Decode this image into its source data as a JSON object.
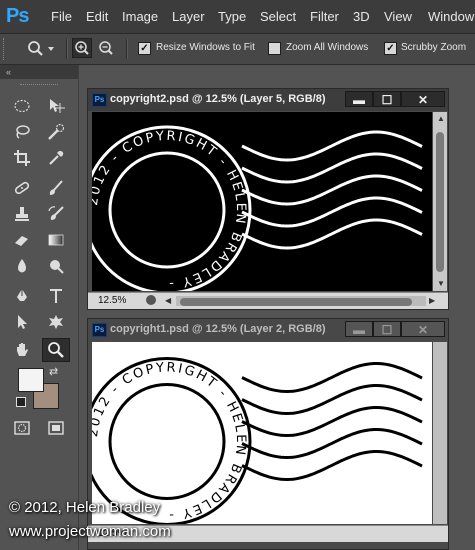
{
  "app": {
    "logo": "Ps"
  },
  "menu": [
    "File",
    "Edit",
    "Image",
    "Layer",
    "Type",
    "Select",
    "Filter",
    "3D",
    "View",
    "Window"
  ],
  "options": {
    "resize_windows": "Resize Windows to Fit",
    "zoom_all": "Zoom All Windows",
    "scrubby_zoom": "Scrubby Zoom",
    "resize_checked": true,
    "zoom_all_checked": false,
    "scrubby_checked": true
  },
  "documents": [
    {
      "title": "copyright2.psd @ 12.5% (Layer 5, RGB/8)",
      "zoom": "12.5%",
      "background": "#000000",
      "ink": "#ffffff",
      "stamp_text": "2012 - COPYRIGHT - HELEN BRADLEY -"
    },
    {
      "title": "copyright1.psd @ 12.5% (Layer 2, RGB/8)",
      "zoom": "12.5%",
      "background": "#ffffff",
      "ink": "#000000",
      "stamp_text": "2012 - COPYRIGHT - HELEN BRADLEY -"
    }
  ],
  "watermark": {
    "line1": "© 2012, Helen Bradley",
    "line2": "www.projectwoman.com"
  },
  "colors": {
    "foreground": "#f4f4f4",
    "background": "#a48e7e"
  }
}
